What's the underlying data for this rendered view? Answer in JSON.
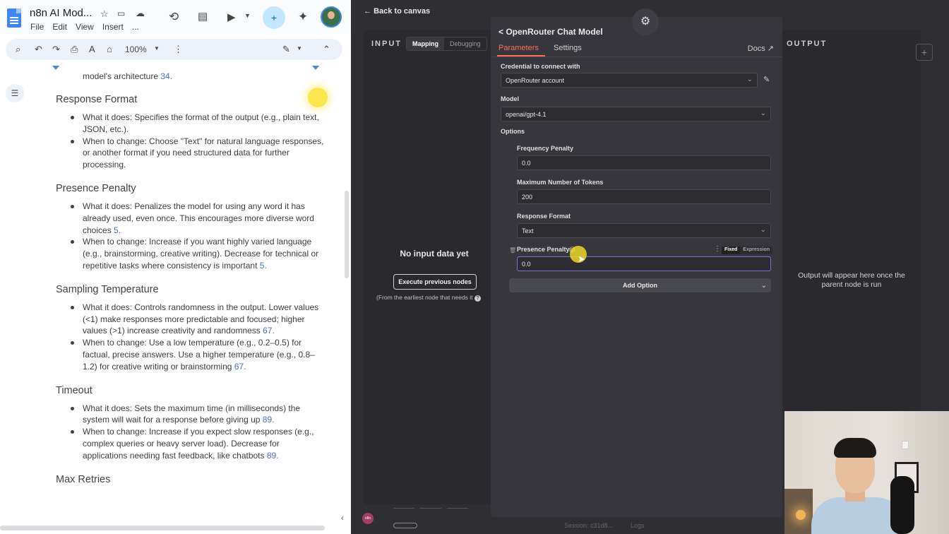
{
  "docs": {
    "title": "n8n AI Mod...",
    "menu": [
      "File",
      "Edit",
      "View",
      "Insert",
      "..."
    ],
    "zoom": "100%",
    "frag_text": "model's architecture ",
    "frag_ref": "34.",
    "sections": [
      {
        "heading": "Response Format",
        "items": [
          {
            "text": "What it does: Specifies the format of the output (e.g., plain text, JSON, etc.).",
            "ref": ""
          },
          {
            "text": "When to change: Choose \"Text\" for natural language responses, or another format if you need structured data for further processing.",
            "ref": ""
          }
        ]
      },
      {
        "heading": "Presence Penalty",
        "items": [
          {
            "text": "What it does: Penalizes the model for using any word it has already used, even once. This encourages more diverse word choices ",
            "ref": "5."
          },
          {
            "text": "When to change: Increase if you want highly varied language (e.g., brainstorming, creative writing). Decrease for technical or repetitive tasks where consistency is important ",
            "ref": "5."
          }
        ]
      },
      {
        "heading": "Sampling Temperature",
        "items": [
          {
            "text": "What it does: Controls randomness in the output. Lower values (<1) make responses more predictable and focused; higher values (>1) increase creativity and randomness ",
            "ref": "67."
          },
          {
            "text": "When to change: Use a low temperature (e.g., 0.2–0.5) for factual, precise answers. Use a higher temperature (e.g., 0.8–1.2) for creative writing or brainstorming ",
            "ref": "67."
          }
        ]
      },
      {
        "heading": "Timeout",
        "items": [
          {
            "text": "What it does: Sets the maximum time (in milliseconds) the system will wait for a response before giving up ",
            "ref": "89."
          },
          {
            "text": "When to change: Increase if you expect slow responses (e.g., complex queries or heavy server load). Decrease for applications needing fast feedback, like chatbots ",
            "ref": "89."
          }
        ]
      },
      {
        "heading": "Max Retries",
        "items": []
      }
    ]
  },
  "n8n": {
    "back_label": "Back to canvas",
    "input": {
      "label": "INPUT",
      "tabs": [
        "Mapping",
        "Debugging"
      ],
      "empty_title": "No input data yet",
      "execute_label": "Execute previous nodes",
      "execute_note": "(From the earliest node that needs it"
    },
    "node": {
      "title": "OpenRouter Chat Model",
      "tabs": [
        "Parameters",
        "Settings"
      ],
      "docs_label": "Docs",
      "credential_label": "Credential to connect with",
      "credential_value": "OpenRouter account",
      "model_label": "Model",
      "model_value": "openai/gpt-4.1",
      "options_label": "Options",
      "frequency_label": "Frequency Penalty",
      "frequency_value": "0.0",
      "max_tokens_label": "Maximum Number of Tokens",
      "max_tokens_value": "200",
      "response_format_label": "Response Format",
      "response_format_value": "Text",
      "presence_label": "Presence Penalty",
      "presence_value": "0.0",
      "mode_fixed": "Fixed",
      "mode_expression": "Expression",
      "add_option_label": "Add Option"
    },
    "output": {
      "label": "OUTPUT",
      "message": "Output will appear here once the parent node is run"
    },
    "footer": {
      "session": "Session: c31d8...",
      "logs": "Logs"
    }
  }
}
